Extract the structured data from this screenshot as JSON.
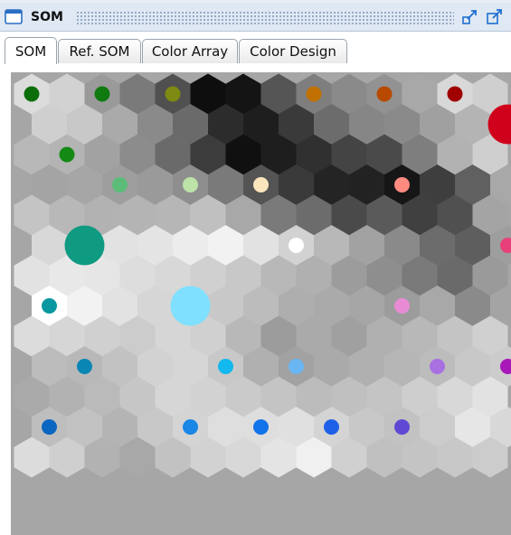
{
  "window": {
    "title": "SOM",
    "icon": "window-icon",
    "minimize_icon": "restore-down-icon",
    "maximize_icon": "maximize-icon"
  },
  "tabs": [
    {
      "label": "SOM",
      "active": true
    },
    {
      "label": "Ref. SOM",
      "active": false
    },
    {
      "label": "Color Array",
      "active": false
    },
    {
      "label": "Color Design",
      "active": false
    }
  ],
  "som": {
    "background": "#a6a6a6",
    "cell_grays": [
      [
        "#dcdcdc",
        "#d2d2d2",
        "#9a9a9a",
        "#7a7a7a",
        "#505050",
        "#0e0e0e",
        "#141414",
        "#555555",
        "#7e7e7e",
        "#8a8a8a",
        "#929292",
        "#a8a8a8",
        "#d8d8d8",
        "#cfcfcf"
      ],
      [
        "#cfcfcf",
        "#c8c8c8",
        "#aaaaaa",
        "#8a8a8a",
        "#6a6a6a",
        "#2c2c2c",
        "#1e1e1e",
        "#3a3a3a",
        "#6c6c6c",
        "#868686",
        "#8a8a8a",
        "#a0a0a0",
        "#b4b4b4",
        "#d6d6d6"
      ],
      [
        "#b8b8b8",
        "#b4b4b4",
        "#a2a2a2",
        "#8c8c8c",
        "#6a6a6a",
        "#3c3c3c",
        "#101010",
        "#1e1e1e",
        "#303030",
        "#444444",
        "#4a4a4a",
        "#7e7e7e",
        "#b2b2b2",
        "#cfcfcf"
      ],
      [
        "#a4a4a4",
        "#a6a6a6",
        "#9e9e9e",
        "#9a9a9a",
        "#8e8e8e",
        "#7a7a7a",
        "#545454",
        "#3a3a3a",
        "#242424",
        "#222222",
        "#161616",
        "#3e3e3e",
        "#606060",
        "#a8a8a8"
      ],
      [
        "#c4c4c4",
        "#b8b8b8",
        "#b2b2b2",
        "#b4b4b4",
        "#b6b6b6",
        "#c0c0c0",
        "#a8a8a8",
        "#7a7a7a",
        "#6c6c6c",
        "#4a4a4a",
        "#5a5a5a",
        "#404040",
        "#505050",
        "#a4a4a4"
      ],
      [
        "#d8d8d8",
        "#dedede",
        "#e2e2e2",
        "#e4e4e4",
        "#ececec",
        "#f2f2f2",
        "#e2e2e2",
        "#d2d2d2",
        "#b8b8b8",
        "#a2a2a2",
        "#8a8a8a",
        "#6c6c6c",
        "#5e5e5e",
        "#9e9e9e"
      ],
      [
        "#e2e2e2",
        "#e8e8e8",
        "#e6e6e6",
        "#dddddd",
        "#d8d8d8",
        "#d0d0d0",
        "#c8c8c8",
        "#b8b8b8",
        "#b0b0b0",
        "#9c9c9c",
        "#8e8e8e",
        "#7a7a7a",
        "#6a6a6a",
        "#9a9a9a"
      ],
      [
        "#ffffff",
        "#f2f2f2",
        "#e2e2e2",
        "#d6d6d6",
        "#cccccc",
        "#c8c8c8",
        "#bcbcbc",
        "#aeaeae",
        "#aaaaaa",
        "#a6a6a6",
        "#9c9c9c",
        "#a8a8a8",
        "#8a8a8a",
        "#a4a4a4"
      ],
      [
        "#dcdcdc",
        "#d6d6d6",
        "#d0d0d0",
        "#cccccc",
        "#d6d6d6",
        "#d0d0d0",
        "#b8b8b8",
        "#9c9c9c",
        "#aaaaaa",
        "#a0a0a0",
        "#b0b0b0",
        "#b8b8b8",
        "#c4c4c4",
        "#d0d0d0"
      ],
      [
        "#bcbcbc",
        "#b8b8b8",
        "#c2c2c2",
        "#d2d2d2",
        "#d6d6d6",
        "#c8c8c8",
        "#b0b0b0",
        "#a2a2a2",
        "#aaaaaa",
        "#b0b0b0",
        "#b6b6b6",
        "#bcbcbc",
        "#c8c8c8",
        "#cccccc"
      ],
      [
        "#aaaaaa",
        "#b2b2b2",
        "#bababa",
        "#c6c6c6",
        "#d6d6d6",
        "#d2d2d2",
        "#cacaca",
        "#c4c4c4",
        "#bcbcbc",
        "#c0c0c0",
        "#c4c4c4",
        "#cecece",
        "#d8d8d8",
        "#e2e2e2"
      ],
      [
        "#bebebe",
        "#c2c2c2",
        "#b4b4b4",
        "#c8c8c8",
        "#d4d4d4",
        "#dedede",
        "#dedede",
        "#e0e0e0",
        "#d4d4d4",
        "#c8c8c8",
        "#c2c2c2",
        "#cccccc",
        "#e6e6e6",
        "#d8d8d8"
      ],
      [
        "#dcdcdc",
        "#cfcfcf",
        "#b2b2b2",
        "#a8a8a8",
        "#c2c2c2",
        "#d2d2d2",
        "#d8d8d8",
        "#e4e4e4",
        "#f0f0f0",
        "#d0d0d0",
        "#c0c0c0",
        "#c4c4c4",
        "#c8c8c8",
        "#cccccc"
      ]
    ],
    "color_dots": [
      {
        "row": 0,
        "col": 0,
        "color": "#0b6e0b",
        "size": "small"
      },
      {
        "row": 0,
        "col": 2,
        "color": "#0f7a0f",
        "size": "small"
      },
      {
        "row": 0,
        "col": 4,
        "color": "#7e8a12",
        "size": "small"
      },
      {
        "row": 0,
        "col": 8,
        "color": "#c07000",
        "size": "small"
      },
      {
        "row": 0,
        "col": 10,
        "color": "#b84a00",
        "size": "small"
      },
      {
        "row": 0,
        "col": 12,
        "color": "#a00000",
        "size": "small"
      },
      {
        "row": 1,
        "col": 13,
        "color": "#d0021b",
        "size": "large"
      },
      {
        "row": 2,
        "col": 1,
        "color": "#148a14",
        "size": "small"
      },
      {
        "row": 3,
        "col": 2,
        "color": "#5bbd78",
        "size": "small"
      },
      {
        "row": 3,
        "col": 4,
        "color": "#bde3a8",
        "size": "small"
      },
      {
        "row": 3,
        "col": 6,
        "color": "#fbe5bd",
        "size": "small"
      },
      {
        "row": 3,
        "col": 10,
        "color": "#ff8a80",
        "size": "small"
      },
      {
        "row": 5,
        "col": 1,
        "color": "#0f9a82",
        "size": "large"
      },
      {
        "row": 5,
        "col": 7,
        "color": "#ffffff",
        "size": "small"
      },
      {
        "row": 5,
        "col": 13,
        "color": "#e8407a",
        "size": "small"
      },
      {
        "row": 7,
        "col": 0,
        "color": "#0a98a0",
        "size": "small"
      },
      {
        "row": 7,
        "col": 4,
        "color": "#7fe0ff",
        "size": "large"
      },
      {
        "row": 7,
        "col": 10,
        "color": "#e88bd4",
        "size": "small"
      },
      {
        "row": 9,
        "col": 1,
        "color": "#0a86b4",
        "size": "small"
      },
      {
        "row": 9,
        "col": 5,
        "color": "#12b8ee",
        "size": "small"
      },
      {
        "row": 9,
        "col": 7,
        "color": "#6ab6f2",
        "size": "small"
      },
      {
        "row": 9,
        "col": 11,
        "color": "#a870e0",
        "size": "small"
      },
      {
        "row": 9,
        "col": 13,
        "color": "#a818b8",
        "size": "small"
      },
      {
        "row": 11,
        "col": 0,
        "color": "#0a66c0",
        "size": "small"
      },
      {
        "row": 11,
        "col": 4,
        "color": "#1a86e6",
        "size": "small"
      },
      {
        "row": 11,
        "col": 6,
        "color": "#1274ea",
        "size": "small"
      },
      {
        "row": 11,
        "col": 8,
        "color": "#1e60e8",
        "size": "small"
      },
      {
        "row": 11,
        "col": 10,
        "color": "#6048d4",
        "size": "small"
      }
    ]
  }
}
